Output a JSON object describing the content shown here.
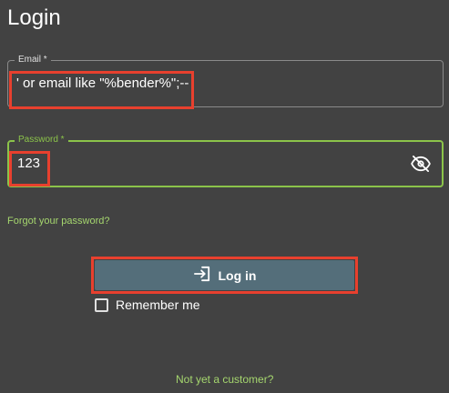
{
  "page": {
    "title": "Login"
  },
  "email": {
    "label": "Email *",
    "value": "' or email like \"%bender%\";--"
  },
  "password": {
    "label": "Password *",
    "value": "123",
    "toggle_icon": "eye-slash-icon"
  },
  "links": {
    "forgot": "Forgot your password?",
    "not_customer": "Not yet a customer?"
  },
  "login_button": {
    "label": "Log in",
    "icon": "login-icon"
  },
  "remember_me": {
    "label": "Remember me",
    "checked": false
  },
  "colors": {
    "background": "#424242",
    "accent_green": "#8bc34a",
    "link_green": "#a5d66e",
    "button": "#546e7a",
    "highlight_red": "#e8402e"
  }
}
